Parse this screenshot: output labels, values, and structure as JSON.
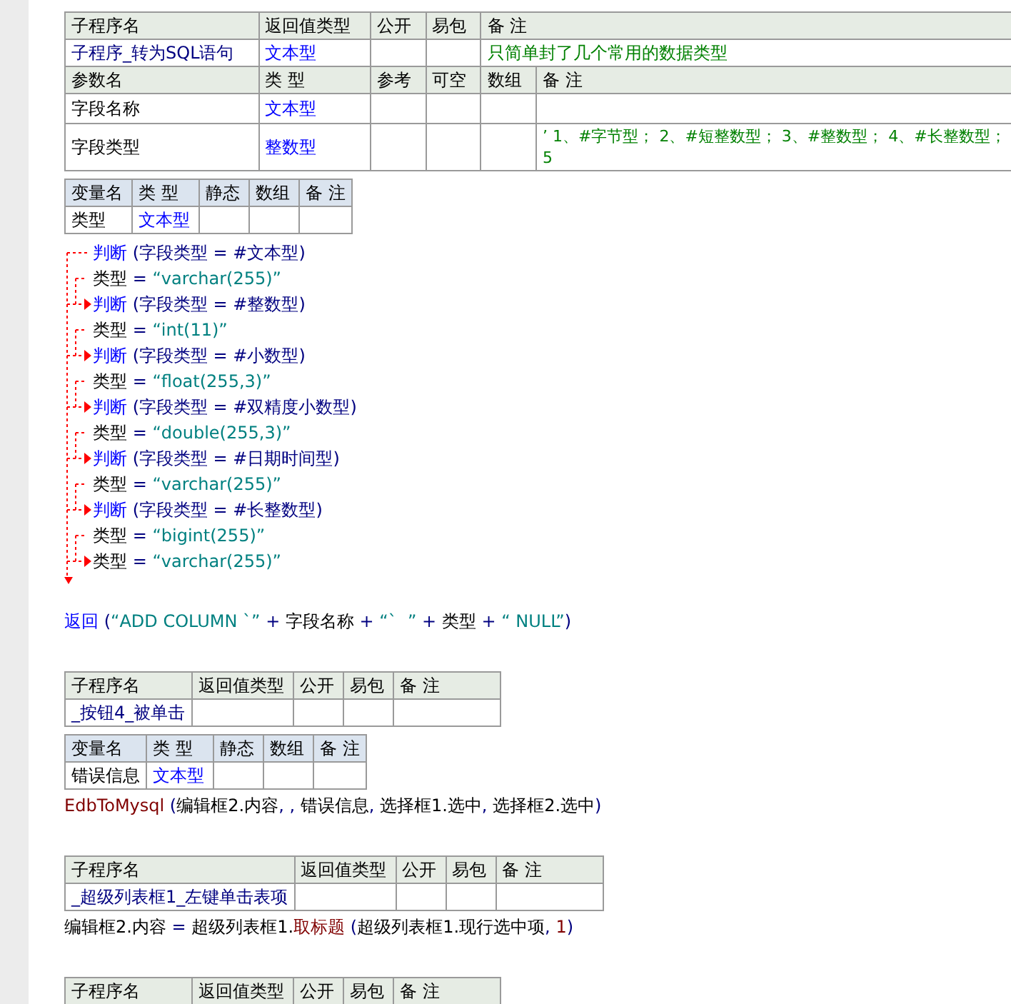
{
  "blocks": [
    {
      "kind": "sub",
      "headers": [
        "子程序名",
        "返回值类型",
        "公开",
        "易包",
        "备 注"
      ],
      "name": "子程序_转为SQL语句",
      "return_type": "文本型",
      "comment": "只简单封了几个常用的数据类型",
      "param_headers": [
        "参数名",
        "类 型",
        "参考",
        "可空",
        "数组",
        "备 注"
      ],
      "params": [
        {
          "name": "字段名称",
          "type": "文本型"
        },
        {
          "name": "字段类型",
          "type": "整数型",
          "comment": "’ 1、#字节型； 2、#短整数型； 3、#整数型； 4、#长整数型； 5"
        }
      ]
    },
    {
      "kind": "vars",
      "headers": [
        "变量名",
        "类 型",
        "静态",
        "数组",
        "备 注"
      ],
      "rows": [
        {
          "name": "类型",
          "type": "文本型"
        }
      ]
    },
    {
      "kind": "flow",
      "lines": [
        {
          "target": false,
          "segs": [
            {
              "text": "判断",
              "kind": "cmd"
            },
            {
              "text": " (字段类型 = #文本型)",
              "kind": "op"
            }
          ]
        },
        {
          "target": false,
          "segs": [
            {
              "text": "类型",
              "kind": "var"
            },
            {
              "text": " = ",
              "kind": "op"
            },
            {
              "text": "“varchar(255)”",
              "kind": "str"
            }
          ]
        },
        {
          "target": true,
          "segs": [
            {
              "text": "判断",
              "kind": "cmd"
            },
            {
              "text": " (字段类型 = #整数型)",
              "kind": "op"
            }
          ]
        },
        {
          "target": false,
          "segs": [
            {
              "text": "类型",
              "kind": "var"
            },
            {
              "text": " = ",
              "kind": "op"
            },
            {
              "text": "“int(11)”",
              "kind": "str"
            }
          ]
        },
        {
          "target": true,
          "segs": [
            {
              "text": "判断",
              "kind": "cmd"
            },
            {
              "text": " (字段类型 = #小数型)",
              "kind": "op"
            }
          ]
        },
        {
          "target": false,
          "segs": [
            {
              "text": "类型",
              "kind": "var"
            },
            {
              "text": " = ",
              "kind": "op"
            },
            {
              "text": "“float(255,3)”",
              "kind": "str"
            }
          ]
        },
        {
          "target": true,
          "segs": [
            {
              "text": "判断",
              "kind": "cmd"
            },
            {
              "text": " (字段类型 = #双精度小数型)",
              "kind": "op"
            }
          ]
        },
        {
          "target": false,
          "segs": [
            {
              "text": "类型",
              "kind": "var"
            },
            {
              "text": " = ",
              "kind": "op"
            },
            {
              "text": "“double(255,3)”",
              "kind": "str"
            }
          ]
        },
        {
          "target": true,
          "segs": [
            {
              "text": "判断",
              "kind": "cmd"
            },
            {
              "text": " (字段类型 = #日期时间型)",
              "kind": "op"
            }
          ]
        },
        {
          "target": false,
          "segs": [
            {
              "text": "类型",
              "kind": "var"
            },
            {
              "text": " = ",
              "kind": "op"
            },
            {
              "text": "“varchar(255)”",
              "kind": "str"
            }
          ]
        },
        {
          "target": true,
          "segs": [
            {
              "text": "判断",
              "kind": "cmd"
            },
            {
              "text": " (字段类型 = #长整数型)",
              "kind": "op"
            }
          ]
        },
        {
          "target": false,
          "segs": [
            {
              "text": "类型",
              "kind": "var"
            },
            {
              "text": " = ",
              "kind": "op"
            },
            {
              "text": "“bigint(255)”",
              "kind": "str"
            }
          ]
        },
        {
          "target": true,
          "segs": [
            {
              "text": "类型",
              "kind": "var"
            },
            {
              "text": " = ",
              "kind": "op"
            },
            {
              "text": "“varchar(255)”",
              "kind": "str"
            }
          ]
        }
      ]
    },
    {
      "kind": "code",
      "lines": [
        {
          "segs": [
            {
              "text": "返回",
              "kind": "cmd"
            },
            {
              "text": " (",
              "kind": "op"
            },
            {
              "text": "“ADD COLUMN `”",
              "kind": "str"
            },
            {
              "text": " + ",
              "kind": "op"
            },
            {
              "text": "字段名称",
              "kind": "var"
            },
            {
              "text": " + ",
              "kind": "op"
            },
            {
              "text": "“`  ”",
              "kind": "str"
            },
            {
              "text": " + ",
              "kind": "op"
            },
            {
              "text": "类型",
              "kind": "var"
            },
            {
              "text": " + ",
              "kind": "op"
            },
            {
              "text": "“ NULL”",
              "kind": "str"
            },
            {
              "text": ")",
              "kind": "op"
            }
          ]
        }
      ]
    },
    {
      "kind": "sub",
      "headers": [
        "子程序名",
        "返回值类型",
        "公开",
        "易包",
        "备 注"
      ],
      "name": "_按钮4_被单击"
    },
    {
      "kind": "vars",
      "headers": [
        "变量名",
        "类 型",
        "静态",
        "数组",
        "备 注"
      ],
      "rows": [
        {
          "name": "错误信息",
          "type": "文本型"
        }
      ]
    },
    {
      "kind": "code",
      "lines": [
        {
          "segs": [
            {
              "text": "EdbToMysql",
              "kind": "fn"
            },
            {
              "text": " (",
              "kind": "op"
            },
            {
              "text": "编辑框2.内容",
              "kind": "var"
            },
            {
              "text": ", , ",
              "kind": "op"
            },
            {
              "text": "错误信息",
              "kind": "var"
            },
            {
              "text": ", ",
              "kind": "op"
            },
            {
              "text": "选择框1.选中",
              "kind": "var"
            },
            {
              "text": ", ",
              "kind": "op"
            },
            {
              "text": "选择框2.选中",
              "kind": "var"
            },
            {
              "text": ")",
              "kind": "op"
            }
          ]
        }
      ]
    },
    {
      "kind": "sub",
      "headers": [
        "子程序名",
        "返回值类型",
        "公开",
        "易包",
        "备 注"
      ],
      "name": "_超级列表框1_左键单击表项"
    },
    {
      "kind": "code",
      "lines": [
        {
          "segs": [
            {
              "text": "编辑框2.内容",
              "kind": "var"
            },
            {
              "text": " = ",
              "kind": "op"
            },
            {
              "text": "超级列表框1.",
              "kind": "var"
            },
            {
              "text": "取标题",
              "kind": "fn"
            },
            {
              "text": " (",
              "kind": "op"
            },
            {
              "text": "超级列表框1.现行选中项",
              "kind": "var"
            },
            {
              "text": ", ",
              "kind": "op"
            },
            {
              "text": "1",
              "kind": "fn"
            },
            {
              "text": ")",
              "kind": "op"
            }
          ]
        }
      ]
    },
    {
      "kind": "sub",
      "headers": [
        "子程序名",
        "返回值类型",
        "公开",
        "易包",
        "备 注"
      ]
    }
  ]
}
